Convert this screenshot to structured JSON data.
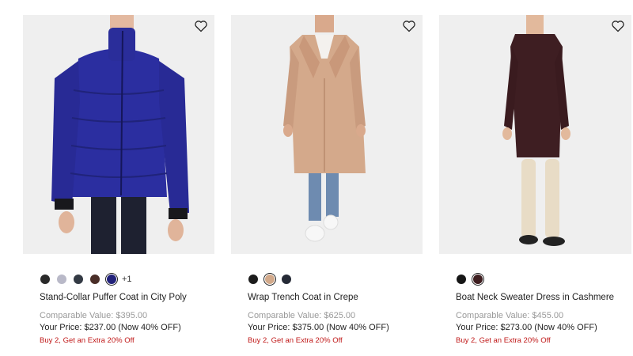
{
  "products": [
    {
      "name": "Stand-Collar Puffer Coat in City Poly",
      "comparable": "Comparable Value: $395.00",
      "price": "Your Price: $237.00 (Now 40% OFF)",
      "promo": "Buy 2, Get an Extra 20% Off",
      "more_colors": "+1",
      "swatches": [
        {
          "color": "#2a2a2a",
          "selected": false
        },
        {
          "color": "#b9b9c8",
          "selected": false
        },
        {
          "color": "#333a44",
          "selected": false
        },
        {
          "color": "#4a2e28",
          "selected": false
        },
        {
          "color": "#22227a",
          "selected": true
        }
      ]
    },
    {
      "name": "Wrap Trench Coat in Crepe",
      "comparable": "Comparable Value: $625.00",
      "price": "Your Price: $375.00 (Now 40% OFF)",
      "promo": "Buy 2, Get an Extra 20% Off",
      "swatches": [
        {
          "color": "#1c1c1c",
          "selected": false
        },
        {
          "color": "#d2a98a",
          "selected": true
        },
        {
          "color": "#252a36",
          "selected": false
        }
      ]
    },
    {
      "name": "Boat Neck Sweater Dress in Cashmere",
      "comparable": "Comparable Value: $455.00",
      "price": "Your Price: $273.00 (Now 40% OFF)",
      "promo": "Buy 2, Get an Extra 20% Off",
      "swatches": [
        {
          "color": "#161616",
          "selected": false
        },
        {
          "color": "#3e1e20",
          "selected": true
        }
      ]
    }
  ],
  "colors": {
    "promo": "#c01818",
    "muted": "#9a9a9a",
    "image_bg": "#efefef"
  }
}
